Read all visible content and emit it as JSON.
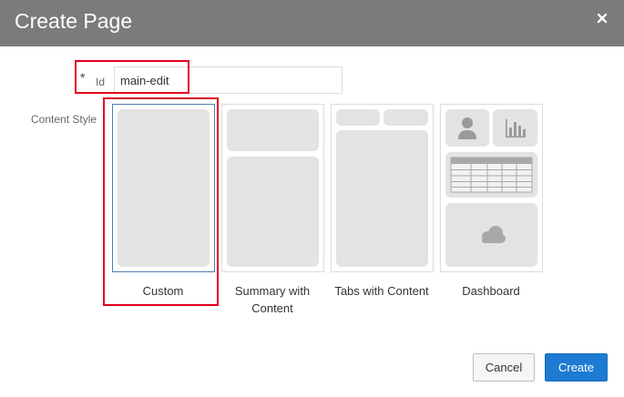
{
  "dialog": {
    "title": "Create Page",
    "close_icon": "close-icon"
  },
  "form": {
    "id_required_marker": "*",
    "id_label": "Id",
    "id_value": "main-edit",
    "content_style_label": "Content Style"
  },
  "styles": [
    {
      "key": "custom",
      "label": "Custom",
      "selected": true
    },
    {
      "key": "summary",
      "label": "Summary with Content",
      "selected": false
    },
    {
      "key": "tabs",
      "label": "Tabs with Content",
      "selected": false
    },
    {
      "key": "dashboard",
      "label": "Dashboard",
      "selected": false,
      "icons": [
        "person-icon",
        "bar-chart-icon",
        "table-grid-icon",
        "cloud-icon"
      ]
    }
  ],
  "buttons": {
    "cancel_label": "Cancel",
    "create_label": "Create"
  },
  "colors": {
    "titlebar": "#7b7b7b",
    "primary": "#1d7bd3",
    "highlight": "#e1001e",
    "selected_border": "#4f7fb0"
  }
}
